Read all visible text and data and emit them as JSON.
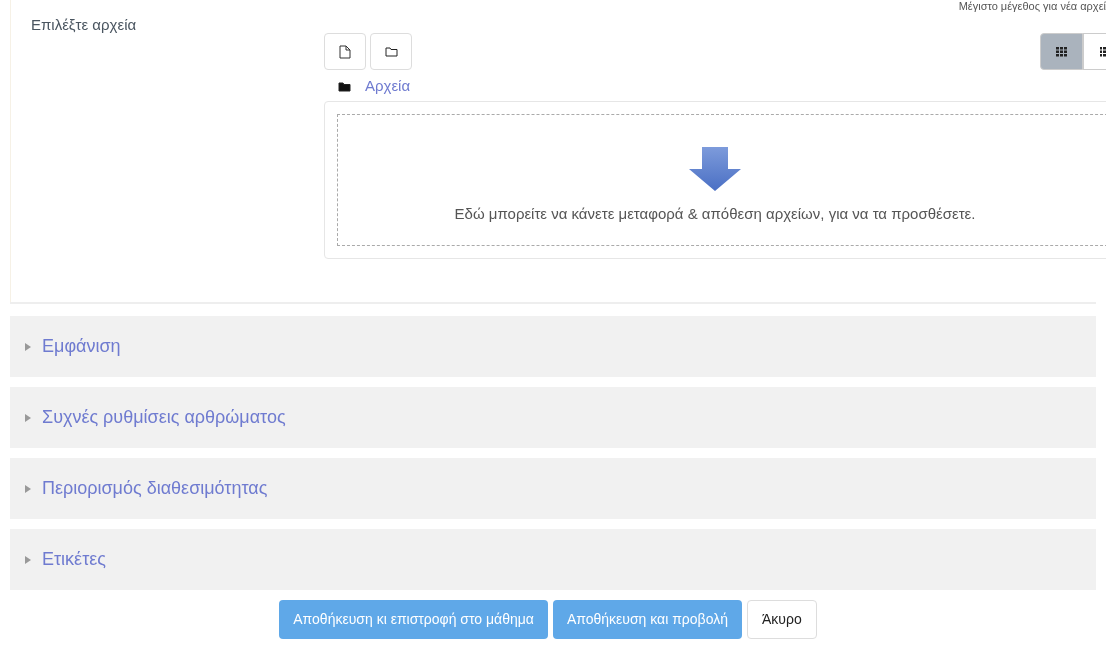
{
  "field_label": "Επιλέξτε αρχεία",
  "max_size_note": "Μέγιστο μέγεθος για νέα αρχεί",
  "view_modes": [
    {
      "kind": "grid",
      "selected": true
    },
    {
      "kind": "list",
      "selected": false
    }
  ],
  "breadcrumb": "Αρχεία",
  "dropzone_text": "Εδώ μπορείτε να κάνετε μεταφορά & απόθεση αρχείων, για να τα προσθέσετε.",
  "sections": [
    {
      "title": "Εμφάνιση",
      "expanded": false
    },
    {
      "title": "Συχνές ρυθμίσεις αρθρώματος",
      "expanded": false
    },
    {
      "title": "Περιορισμός διαθεσιμότητας",
      "expanded": false
    },
    {
      "title": "Ετικέτες",
      "expanded": false
    }
  ],
  "buttons": [
    {
      "label": "Αποθήκευση κι επιστροφή στο μάθημα",
      "kind": "primary"
    },
    {
      "label": "Αποθήκευση και προβολή",
      "kind": "primary"
    },
    {
      "label": "Άκυρο",
      "kind": "secondary"
    }
  ]
}
